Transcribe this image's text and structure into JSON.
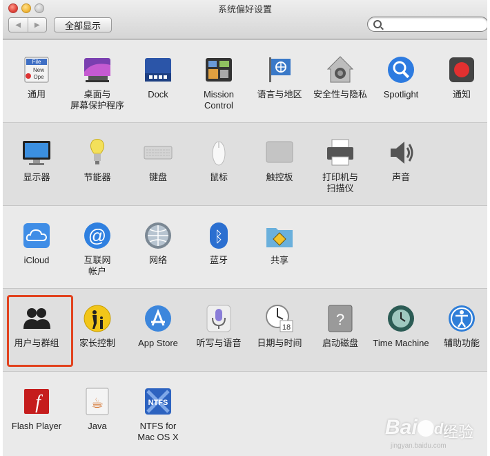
{
  "window": {
    "title": "系统偏好设置",
    "show_all_label": "全部显示",
    "back_symbol": "◀",
    "forward_symbol": "▶",
    "search": {
      "value": "",
      "placeholder": ""
    }
  },
  "rows": [
    {
      "panes": [
        {
          "name": "通用",
          "icon": "general-icon"
        },
        {
          "name": "桌面与\n屏幕保护程序",
          "icon": "desktop-screensaver-icon"
        },
        {
          "name": "Dock",
          "icon": "dock-icon"
        },
        {
          "name": "Mission\nControl",
          "icon": "mission-control-icon"
        },
        {
          "name": "语言与地区",
          "icon": "language-region-icon"
        },
        {
          "name": "安全性与隐私",
          "icon": "security-privacy-icon"
        },
        {
          "name": "Spotlight",
          "icon": "spotlight-icon"
        },
        {
          "name": "通知",
          "icon": "notifications-icon"
        }
      ]
    },
    {
      "panes": [
        {
          "name": "显示器",
          "icon": "displays-icon"
        },
        {
          "name": "节能器",
          "icon": "energy-saver-icon"
        },
        {
          "name": "键盘",
          "icon": "keyboard-icon"
        },
        {
          "name": "鼠标",
          "icon": "mouse-icon"
        },
        {
          "name": "触控板",
          "icon": "trackpad-icon"
        },
        {
          "name": "打印机与\n扫描仪",
          "icon": "printers-scanners-icon"
        },
        {
          "name": "声音",
          "icon": "sound-icon"
        }
      ]
    },
    {
      "panes": [
        {
          "name": "iCloud",
          "icon": "icloud-icon"
        },
        {
          "name": "互联网\n帐户",
          "icon": "internet-accounts-icon"
        },
        {
          "name": "网络",
          "icon": "network-icon"
        },
        {
          "name": "蓝牙",
          "icon": "bluetooth-icon"
        },
        {
          "name": "共享",
          "icon": "sharing-icon"
        }
      ]
    },
    {
      "panes": [
        {
          "name": "用户与群组",
          "icon": "users-groups-icon"
        },
        {
          "name": "家长控制",
          "icon": "parental-controls-icon"
        },
        {
          "name": "App Store",
          "icon": "app-store-icon"
        },
        {
          "name": "听写与语音",
          "icon": "dictation-speech-icon"
        },
        {
          "name": "日期与时间",
          "icon": "date-time-icon"
        },
        {
          "name": "启动磁盘",
          "icon": "startup-disk-icon"
        },
        {
          "name": "Time Machine",
          "icon": "time-machine-icon"
        },
        {
          "name": "辅助功能",
          "icon": "accessibility-icon"
        }
      ]
    },
    {
      "panes": [
        {
          "name": "Flash Player",
          "icon": "flash-player-icon"
        },
        {
          "name": "Java",
          "icon": "java-icon"
        },
        {
          "name": "NTFS for\nMac OS X",
          "icon": "ntfs-icon"
        }
      ]
    }
  ],
  "icon_text": {
    "general_file": "File",
    "general_new": "New",
    "general_open": "Ope",
    "date_day": "18",
    "ntfs": "NTFS",
    "flash": "f",
    "java": "☕",
    "bluetooth": "ᛒ",
    "at": "@",
    "question": "?"
  },
  "highlight_color": "#e2421e",
  "watermark": {
    "brand": "Bai",
    "brand2": "du",
    "text": "经验",
    "sub": "jingyan.baidu.com"
  }
}
